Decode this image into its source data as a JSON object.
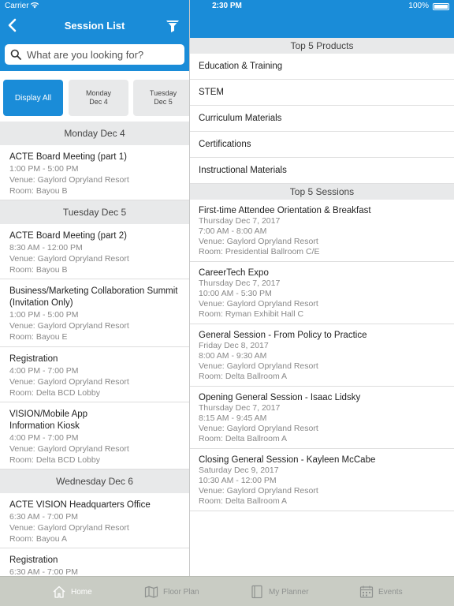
{
  "status_bar": {
    "carrier": "Carrier",
    "time": "2:30 PM",
    "battery": "100%"
  },
  "left": {
    "title": "Session List",
    "search_placeholder": "What are you looking for?",
    "day_tabs": [
      {
        "line1": "Display All",
        "line2": ""
      },
      {
        "line1": "Monday",
        "line2": "Dec 4"
      },
      {
        "line1": "Tuesday",
        "line2": "Dec 5"
      }
    ],
    "sections": [
      {
        "header": "Monday Dec 4",
        "sessions": [
          {
            "title": "ACTE Board Meeting (part 1)",
            "time": "1:00 PM - 5:00 PM",
            "venue": "Venue: Gaylord Opryland Resort",
            "room": "Room: Bayou B"
          }
        ]
      },
      {
        "header": "Tuesday Dec 5",
        "sessions": [
          {
            "title": "ACTE Board Meeting (part 2)",
            "time": "8:30 AM - 12:00 PM",
            "venue": "Venue: Gaylord Opryland Resort",
            "room": "Room: Bayou B"
          },
          {
            "title": "Business/Marketing Collaboration Summit (Invitation Only)",
            "time": "1:00 PM - 5:00 PM",
            "venue": "Venue: Gaylord Opryland Resort",
            "room": "Room: Bayou E"
          },
          {
            "title": "Registration",
            "time": "4:00 PM - 7:00 PM",
            "venue": "Venue: Gaylord Opryland Resort",
            "room": "Room: Delta BCD Lobby"
          },
          {
            "title": "VISION/Mobile App Information Kiosk",
            "time": "4:00 PM - 7:00 PM",
            "venue": "Venue: Gaylord Opryland Resort",
            "room": "Room: Delta BCD Lobby"
          }
        ]
      },
      {
        "header": "Wednesday Dec 6",
        "sessions": [
          {
            "title": "ACTE VISION Headquarters Office",
            "time": "6:30 AM - 7:00 PM",
            "venue": "Venue: Gaylord Opryland Resort",
            "room": "Room: Bayou A"
          },
          {
            "title": "Registration",
            "time": "6:30 AM - 7:00 PM",
            "venue": "",
            "room": ""
          }
        ]
      }
    ]
  },
  "right": {
    "products_header": "Top 5 Products",
    "products": [
      "Education & Training",
      "STEM",
      "Curriculum Materials",
      "Certifications",
      "Instructional Materials"
    ],
    "sessions_header": "Top 5 Sessions",
    "sessions": [
      {
        "title": "First-time Attendee Orientation & Breakfast",
        "date": "Thursday Dec 7, 2017",
        "time": "7:00 AM - 8:00 AM",
        "venue": "Venue: Gaylord Opryland Resort",
        "room": "Room: Presidential Ballroom C/E"
      },
      {
        "title": "CareerTech Expo",
        "date": "Thursday Dec 7, 2017",
        "time": "10:00 AM - 5:30 PM",
        "venue": "Venue: Gaylord Opryland Resort",
        "room": "Room: Ryman Exhibit Hall C"
      },
      {
        "title": "General Session - From Policy to Practice",
        "date": "Friday Dec 8, 2017",
        "time": "8:00 AM - 9:30 AM",
        "venue": "Venue: Gaylord Opryland Resort",
        "room": "Room: Delta Ballroom A"
      },
      {
        "title": "Opening General Session - Isaac Lidsky",
        "date": "Thursday Dec 7, 2017",
        "time": "8:15 AM - 9:45 AM",
        "venue": "Venue: Gaylord Opryland Resort",
        "room": "Room: Delta Ballroom A"
      },
      {
        "title": "Closing General Session - Kayleen McCabe",
        "date": "Saturday Dec 9, 2017",
        "time": "10:30 AM - 12:00 PM",
        "venue": "Venue: Gaylord Opryland Resort",
        "room": "Room: Delta Ballroom A"
      }
    ]
  },
  "tab_bar": [
    {
      "label": "Home",
      "icon": "home-icon",
      "active": true
    },
    {
      "label": "Floor Plan",
      "icon": "map-icon",
      "active": false
    },
    {
      "label": "My Planner",
      "icon": "book-icon",
      "active": false
    },
    {
      "label": "Events",
      "icon": "calendar-icon",
      "active": false
    }
  ],
  "colors": {
    "primary": "#1a8cd8",
    "section_bg": "#e8e9ea",
    "tab_bar_bg": "#c9ccc4"
  }
}
